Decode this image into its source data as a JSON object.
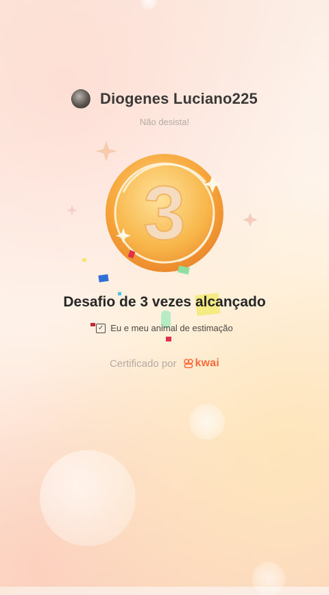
{
  "user": {
    "name": "Diogenes Luciano225",
    "tagline": "Não desista!"
  },
  "medal": {
    "number": "3",
    "colors": {
      "outer": "#f7a63a",
      "inner": "#f9c55e",
      "numeral": "#f6e2c8"
    }
  },
  "achievement": {
    "title": "Desafio de 3 vezes alcançado",
    "pet_label": "Eu e meu animal de estimação",
    "pet_icon": "checkbox-icon"
  },
  "certification": {
    "prefix": "Certificado por",
    "brand": "kwai",
    "brand_color": "#ff6a3c"
  }
}
